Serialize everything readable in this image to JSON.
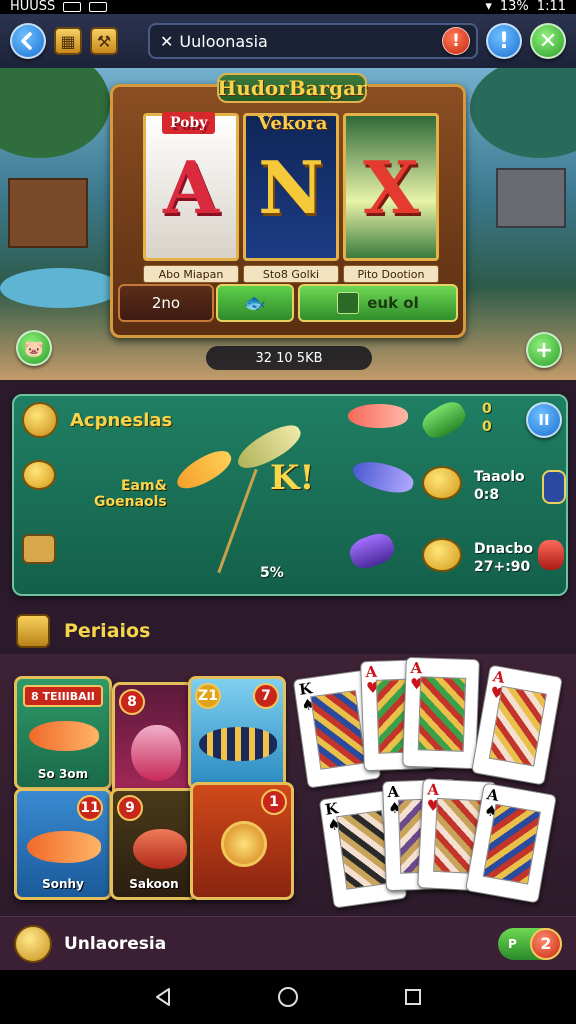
{
  "status_bar": {
    "left_text": "HUUSS",
    "battery": "13%",
    "time": "1:11"
  },
  "top_bar": {
    "search_text": "Uuloonasia",
    "warning_glyph": "!",
    "info_glyph": "!",
    "close_glyph": "✕"
  },
  "slot": {
    "title": "HudorBargar",
    "reels": [
      {
        "letter": "A",
        "tag": "Poby",
        "label": "Abo Miapan"
      },
      {
        "letter": "N",
        "tag": "Vekora",
        "label": "Sto8 Golki"
      },
      {
        "letter": "X",
        "tag": "",
        "label": "Pito Dootion"
      }
    ],
    "bet_button": "2no",
    "spin_button": "euk ol",
    "credit": "32 10 5KB"
  },
  "fishing": {
    "title": "Acpneslas",
    "left_label_1": "Eam&",
    "left_label_2": "Goenaols",
    "center_letter": "K!",
    "center_value": "5%",
    "top_value_1": "0",
    "top_value_2": "0",
    "item_1_title": "Taaolo",
    "item_1_value": "0:8",
    "item_2_title": "Dnacbo",
    "item_2_value": "27+:90",
    "pause_glyph": "II"
  },
  "periods": {
    "title": "Periaios",
    "game_cards": [
      {
        "title": "8 TEIIIBAII",
        "num": "8",
        "caption": "So 3om"
      },
      {
        "title": "",
        "num": "Z1",
        "caption": ""
      },
      {
        "title": "",
        "num": "7",
        "caption": ""
      },
      {
        "title": "",
        "num": "11",
        "caption": "Sonhy"
      },
      {
        "title": "",
        "num": "9",
        "caption": "Sakoon"
      },
      {
        "title": "",
        "num": "1",
        "caption": ""
      }
    ],
    "playing_cards": [
      {
        "rank": "K",
        "suit": "♠"
      },
      {
        "rank": "A",
        "suit": "♥"
      },
      {
        "rank": "A",
        "suit": "♥"
      },
      {
        "rank": "A",
        "suit": "♥"
      },
      {
        "rank": "K",
        "suit": "♠"
      },
      {
        "rank": "A",
        "suit": "♠"
      },
      {
        "rank": "A",
        "suit": "♥"
      },
      {
        "rank": "A",
        "suit": "♠"
      }
    ]
  },
  "bottom_bar": {
    "label": "Unlaoresia",
    "toggle_text": "P",
    "badge": "2"
  },
  "colors": {
    "accent_gold": "#f7d54a",
    "panel_green": "#1f7f63",
    "brand_red": "#d92a3e"
  }
}
